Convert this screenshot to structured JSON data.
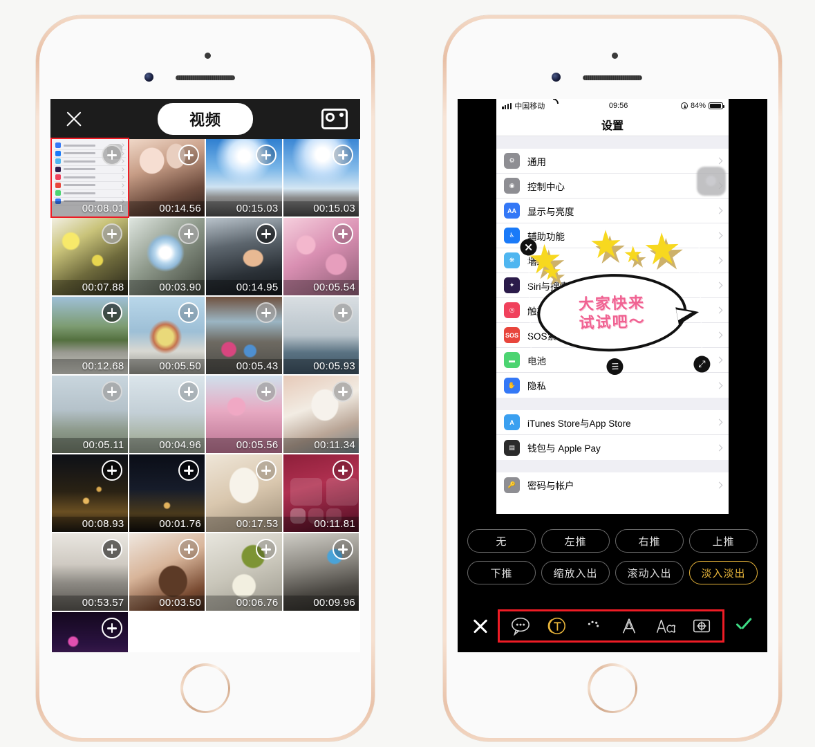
{
  "background_color": "#f7f7f5",
  "left_phone": {
    "picker": {
      "close_label": "✕",
      "tab_label": "视频",
      "camera_icon": "camera-icon",
      "videos": [
        {
          "duration": "00:08.01",
          "thumb": "settings-screen-recording",
          "selected": true,
          "plus_style": "grey"
        },
        {
          "duration": "00:14.56",
          "thumb": "t-face",
          "selected": false,
          "plus_style": "light"
        },
        {
          "duration": "00:15.03",
          "thumb": "t-sky",
          "selected": false,
          "plus_style": "light"
        },
        {
          "duration": "00:15.03",
          "thumb": "t-sky2",
          "selected": false,
          "plus_style": "light"
        },
        {
          "duration": "00:07.88",
          "thumb": "t-yellow",
          "selected": false,
          "plus_style": "grey"
        },
        {
          "duration": "00:03.90",
          "thumb": "t-bubble",
          "selected": false,
          "plus_style": "grey"
        },
        {
          "duration": "00:14.95",
          "thumb": "t-car",
          "selected": false,
          "plus_style": "dark"
        },
        {
          "duration": "00:05.54",
          "thumb": "t-sakura",
          "selected": false,
          "plus_style": "light"
        },
        {
          "duration": "00:12.68",
          "thumb": "t-train",
          "selected": false,
          "plus_style": "dark"
        },
        {
          "duration": "00:05.50",
          "thumb": "t-swing",
          "selected": false,
          "plus_style": "light"
        },
        {
          "duration": "00:05.43",
          "thumb": "t-bumper",
          "selected": false,
          "plus_style": "grey"
        },
        {
          "duration": "00:05.93",
          "thumb": "t-coaster",
          "selected": false,
          "plus_style": "grey"
        },
        {
          "duration": "00:05.11",
          "thumb": "t-tree1",
          "selected": false,
          "plus_style": "grey"
        },
        {
          "duration": "00:04.96",
          "thumb": "t-tree2",
          "selected": false,
          "plus_style": "light"
        },
        {
          "duration": "00:05.56",
          "thumb": "t-sakura2",
          "selected": false,
          "plus_style": "grey"
        },
        {
          "duration": "00:11.34",
          "thumb": "t-dog1",
          "selected": false,
          "plus_style": "grey"
        },
        {
          "duration": "00:08.93",
          "thumb": "t-night1",
          "selected": false,
          "plus_style": "dark"
        },
        {
          "duration": "00:01.76",
          "thumb": "t-night2",
          "selected": false,
          "plus_style": "dark"
        },
        {
          "duration": "00:17.53",
          "thumb": "t-dog2",
          "selected": false,
          "plus_style": "light"
        },
        {
          "duration": "00:11.81",
          "thumb": "control-center",
          "selected": false,
          "plus_style": "light"
        },
        {
          "duration": "00:53.57",
          "thumb": "t-office1",
          "selected": false,
          "plus_style": "dark"
        },
        {
          "duration": "00:03.50",
          "thumb": "t-hair",
          "selected": false,
          "plus_style": "light"
        },
        {
          "duration": "00:06.76",
          "thumb": "t-food",
          "selected": false,
          "plus_style": "light"
        },
        {
          "duration": "00:09.96",
          "thumb": "t-office2",
          "selected": false,
          "plus_style": "light"
        },
        {
          "duration": "",
          "thumb": "t-city",
          "selected": false,
          "plus_style": "light"
        }
      ]
    }
  },
  "right_phone": {
    "ios_preview": {
      "status_bar": {
        "carrier": "中国移动",
        "time": "09:56",
        "battery_percent": "84%",
        "signal_icon": "signal-bars-icon",
        "wifi_icon": "wifi-icon",
        "location_icon": "location-icon",
        "battery_icon": "battery-icon"
      },
      "nav_title": "设置",
      "groups": [
        {
          "rows": [
            {
              "label": "通用",
              "icon": "gear-icon",
              "color": "#8e8e93",
              "glyph": "⚙"
            },
            {
              "label": "控制中心",
              "icon": "control-center-icon",
              "color": "#8e8e93",
              "glyph": "◉"
            },
            {
              "label": "显示与亮度",
              "icon": "display-icon",
              "color": "#3478f6",
              "glyph": "AA"
            },
            {
              "label": "辅助功能",
              "icon": "accessibility-icon",
              "color": "#1a7af8",
              "glyph": "♿"
            },
            {
              "label": "墙纸",
              "icon": "wallpaper-icon",
              "color": "#4fb6f0",
              "glyph": "❋"
            },
            {
              "label": "Siri与搜索",
              "icon": "siri-icon",
              "color": "#2b1b4a",
              "glyph": "✦"
            },
            {
              "label": "触控ID与密码",
              "icon": "touchid-icon",
              "color": "#f0415c",
              "glyph": "◎"
            },
            {
              "label": "SOS紧急联络",
              "icon": "sos-icon",
              "color": "#e8453c",
              "glyph": "SOS"
            },
            {
              "label": "电池",
              "icon": "battery-settings-icon",
              "color": "#4cd471",
              "glyph": "▬"
            },
            {
              "label": "隐私",
              "icon": "privacy-icon",
              "color": "#3478f6",
              "glyph": "✋"
            }
          ]
        },
        {
          "rows": [
            {
              "label": "iTunes Store与App Store",
              "icon": "app-store-icon",
              "color": "#3ba0f0",
              "glyph": "A"
            },
            {
              "label": "钱包与 Apple Pay",
              "icon": "wallet-icon",
              "color": "#2b2b2b",
              "glyph": "▤"
            }
          ]
        },
        {
          "rows": [
            {
              "label": "密码与帐户",
              "icon": "passwords-icon",
              "color": "#8e8e93",
              "glyph": "🔑"
            }
          ]
        }
      ]
    },
    "sticker": {
      "text_line1": "大家快来",
      "text_line2": "试试吧～",
      "text_color": "#f06292",
      "star_color": "#f7d81f",
      "close_handle": "close-icon",
      "resize_handle": "resize-icon",
      "edit_handle": "edit-icon"
    },
    "animations": {
      "row1": [
        {
          "label": "无",
          "active": false
        },
        {
          "label": "左推",
          "active": false
        },
        {
          "label": "右推",
          "active": false
        },
        {
          "label": "上推",
          "active": false
        }
      ],
      "row2": [
        {
          "label": "下推",
          "active": false
        },
        {
          "label": "缩放入出",
          "active": false
        },
        {
          "label": "滚动入出",
          "active": false
        },
        {
          "label": "淡入淡出",
          "active": true
        }
      ],
      "active_color": "#e8b53a"
    },
    "toolbar": {
      "cancel_icon": "close-icon",
      "confirm_icon": "check-icon",
      "confirm_color": "#3ddc84",
      "highlight_color": "#ee1c25",
      "items": [
        {
          "icon": "speech-bubble-icon",
          "label": "气泡",
          "active": false
        },
        {
          "icon": "text-style-icon",
          "label": "字体",
          "active": true
        },
        {
          "icon": "palette-icon",
          "label": "颜色",
          "active": false
        },
        {
          "icon": "outline-text-icon",
          "label": "描边",
          "active": false
        },
        {
          "icon": "font-size-icon",
          "label": "字号",
          "active": false
        },
        {
          "icon": "animation-icon",
          "label": "动画",
          "active": false
        }
      ]
    }
  }
}
